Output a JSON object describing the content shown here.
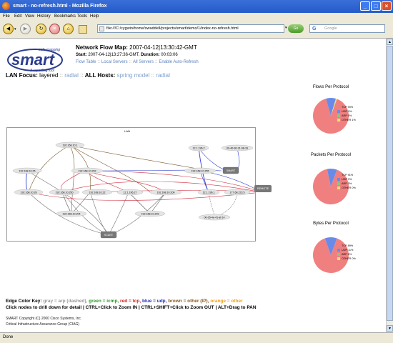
{
  "window": {
    "title": "smart - no-refresh.html - Mozilla Firefox"
  },
  "menu": [
    "File",
    "Edit",
    "View",
    "History",
    "Bookmarks",
    "Tools",
    "Help"
  ],
  "toolbar": {
    "url": "file:///C:/cygwin/home/swaddell/projects/smart/demo/1/index-no-refresh.html",
    "search_placeholder": "Google",
    "go_label": "Go"
  },
  "logo": {
    "tagline_top": "safe mapping",
    "word": "smart",
    "tagline_bottom": "& reporting tool"
  },
  "header": {
    "title": "Network Flow Map:",
    "timestamp": "2007-04-12|13:30:42-GMT",
    "start_label": "Start:",
    "start_value": "2007-04-12|13:27:36-GMT,",
    "duration_label": "Duration:",
    "duration_value": "00:03:06",
    "links": [
      "Flow Table",
      "Local Servers",
      "All Servers",
      "Enable Auto-Refresh"
    ]
  },
  "focus": {
    "lan_label": "LAN Focus:",
    "lan_current": "layered",
    "lan_alt": "radial",
    "hosts_label": "ALL Hosts:",
    "hosts_alt1": "spring model",
    "hosts_alt2": "radial"
  },
  "graph": {
    "cluster_label": "LAN",
    "nodes": [
      "192.168.10.1",
      "12.1.196.2",
      "00-40-96-31-98-16",
      "192.168.10.25",
      "192.168.10.202",
      "192.168.10.255",
      "SMART",
      "192.168.10.28",
      "192.168.10.250",
      "192.168.10.22",
      "12.1.196.27",
      "192.168.10.200",
      "12.1.196.1",
      "177.68.223.5",
      "REMOTE",
      "192.168.10.204",
      "192.168.10.203",
      "00-05-4e-41-af-14",
      "SCANT"
    ]
  },
  "pies": [
    {
      "title": "Flows Per Protocol",
      "legend": [
        "TCP 90%",
        "UDP 9%",
        "ARP 0%",
        "OTHER 1%"
      ]
    },
    {
      "title": "Packets Per Protocol",
      "legend": [
        "TCP 91%",
        "UDP 9%",
        "ARP 0%",
        "OTHER 0%"
      ]
    },
    {
      "title": "Bytes Per Protocol",
      "legend": [
        "TCP 89%",
        "UDP 11%",
        "ARP 0%",
        "OTHER 0%"
      ]
    }
  ],
  "pie_colors": {
    "tcp": "#f08080",
    "udp": "#6a8ae8",
    "arp": "#7ad07a",
    "other": "#f0e070"
  },
  "chart_data": [
    {
      "type": "pie",
      "title": "Flows Per Protocol",
      "categories": [
        "TCP",
        "UDP",
        "ARP",
        "OTHER"
      ],
      "values": [
        90,
        9,
        0,
        1
      ]
    },
    {
      "type": "pie",
      "title": "Packets Per Protocol",
      "categories": [
        "TCP",
        "UDP",
        "ARP",
        "OTHER"
      ],
      "values": [
        91,
        9,
        0,
        0
      ]
    },
    {
      "type": "pie",
      "title": "Bytes Per Protocol",
      "categories": [
        "TCP",
        "UDP",
        "ARP",
        "OTHER"
      ],
      "values": [
        89,
        11,
        0,
        0
      ]
    }
  ],
  "edge_key": {
    "label": "Edge Color Key:",
    "gray": "gray = arp (dashed),",
    "green": "green = icmp,",
    "red": "red = tcp,",
    "blue": "blue = udp,",
    "brown": "brown = other (IP),",
    "orange": "orange = other",
    "instructions": "Click nodes to drill down for detail | CTRL+Click to Zoom IN | CTRL+SHIFT+Click to Zoom OUT | ALT+Drag to PAN"
  },
  "footer": {
    "line1": "SMART Copyright (C) 2000 Cisco Systems, Inc.",
    "line2": "Critical Infrastructure Assurance Group (CIAG)"
  },
  "status": {
    "text": "Done"
  }
}
